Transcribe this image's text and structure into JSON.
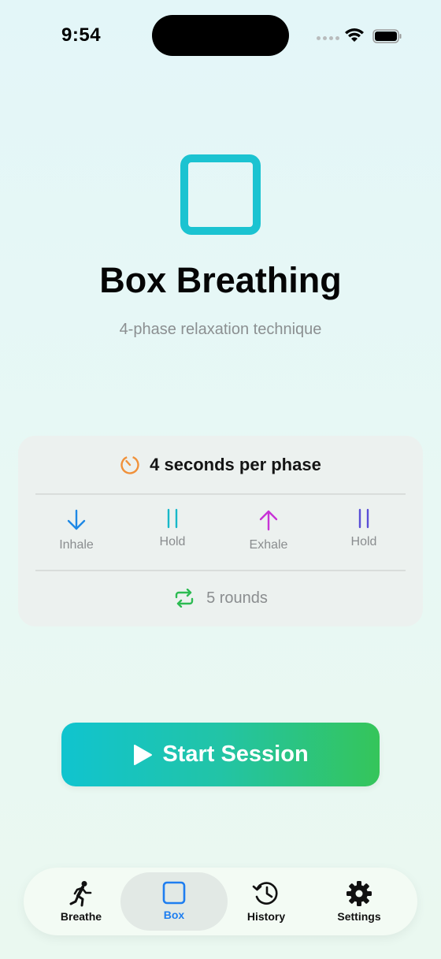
{
  "status_bar": {
    "time": "9:54"
  },
  "hero": {
    "title": "Box Breathing",
    "subtitle": "4-phase relaxation technique"
  },
  "card": {
    "timing_label": "4 seconds per phase",
    "phases": [
      {
        "label": "Inhale",
        "icon": "arrow-down-icon",
        "color": "#1e88e5"
      },
      {
        "label": "Hold",
        "icon": "pause-icon",
        "color": "#17b8c9"
      },
      {
        "label": "Exhale",
        "icon": "arrow-up-icon",
        "color": "#c832d6"
      },
      {
        "label": "Hold",
        "icon": "pause-icon",
        "color": "#5a4fd6"
      }
    ],
    "rounds_label": "5 rounds"
  },
  "start_button": {
    "label": "Start Session"
  },
  "tabs": [
    {
      "label": "Breathe",
      "icon": "running-figure-icon",
      "active": false
    },
    {
      "label": "Box",
      "icon": "square-icon",
      "active": true
    },
    {
      "label": "History",
      "icon": "history-clock-icon",
      "active": false
    },
    {
      "label": "Settings",
      "icon": "gear-icon",
      "active": false
    }
  ],
  "colors": {
    "accent_cyan": "#1bc3d1",
    "timer_orange": "#f0913a",
    "rounds_green": "#2dbb52",
    "tab_active": "#1e7ef0"
  }
}
